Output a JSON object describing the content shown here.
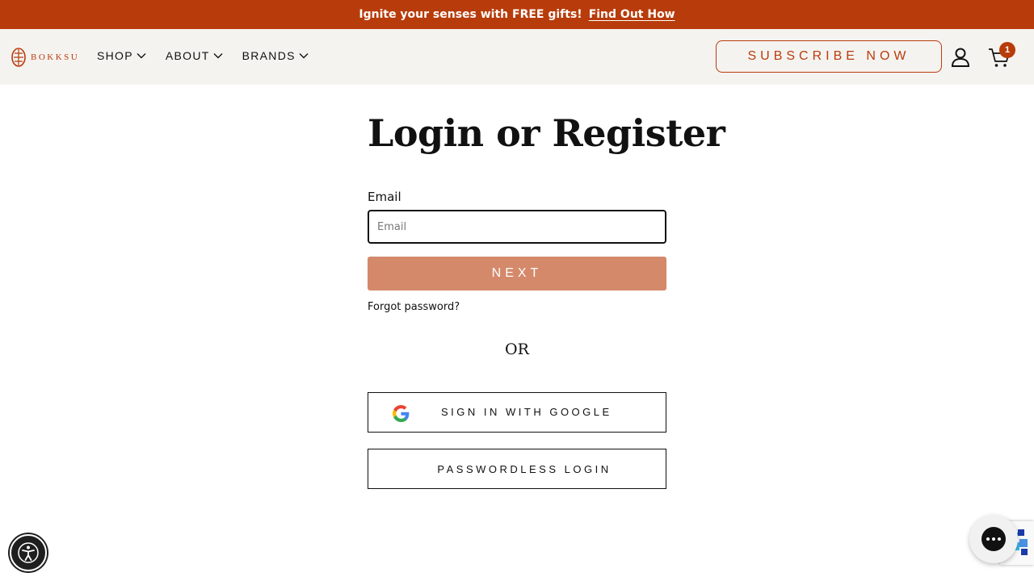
{
  "announcement": {
    "text": "Ignite your senses with FREE gifts!",
    "link_label": "Find Out How"
  },
  "header": {
    "logo_text": "BOKKSU",
    "nav": [
      {
        "label": "SHOP",
        "icon": "chevron-down-icon"
      },
      {
        "label": "ABOUT",
        "icon": "chevron-down-icon"
      },
      {
        "label": "BRANDS",
        "icon": "chevron-down-icon"
      }
    ],
    "subscribe_label": "SUBSCRIBE NOW",
    "cart_count": "1"
  },
  "login": {
    "title": "Login or Register",
    "email_label": "Email",
    "email_placeholder": "Email",
    "email_value": "",
    "next_label": "NEXT",
    "forgot_label": "Forgot password?",
    "or_label": "OR",
    "google_label": "SIGN IN WITH GOOGLE",
    "passwordless_label": "PASSWORDLESS LOGIN"
  },
  "colors": {
    "brand": "#b83c0b",
    "next_button": "#d4896b",
    "header_bg": "#f5f3f0"
  }
}
